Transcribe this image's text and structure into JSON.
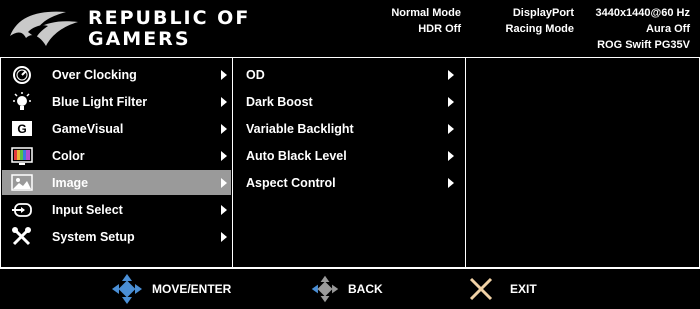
{
  "header": {
    "brand_line1": "REPUBLIC OF",
    "brand_line2": "GAMERS",
    "status": {
      "picture_mode": "Normal Mode",
      "hdr": "HDR Off",
      "input": "DisplayPort",
      "racing": "Racing Mode",
      "resolution": "3440x1440@60 Hz",
      "aura": "Aura Off",
      "model": "ROG Swift PG35V"
    }
  },
  "main_menu": {
    "selected_index": 5,
    "items": [
      {
        "label": "Over Clocking",
        "icon": "speedometer-icon"
      },
      {
        "label": "Blue Light Filter",
        "icon": "bulb-icon"
      },
      {
        "label": "GameVisual",
        "icon": "gamevisual-icon"
      },
      {
        "label": "Color",
        "icon": "color-bars-icon"
      },
      {
        "label": "Image",
        "icon": "image-icon"
      },
      {
        "label": "Input Select",
        "icon": "input-select-icon"
      },
      {
        "label": "System Setup",
        "icon": "tools-icon"
      }
    ]
  },
  "sub_menu": {
    "items": [
      {
        "label": "OD"
      },
      {
        "label": "Dark Boost"
      },
      {
        "label": "Variable Backlight"
      },
      {
        "label": "Auto Black Level"
      },
      {
        "label": "Aspect Control"
      }
    ]
  },
  "footer": {
    "move_label": "MOVE/ENTER",
    "back_label": "BACK",
    "exit_label": "EXIT"
  },
  "colors": {
    "background": "#000000",
    "selected": "#9a9a9a",
    "dpad": "#4a8fd6",
    "exit": "#f1d2a6"
  }
}
